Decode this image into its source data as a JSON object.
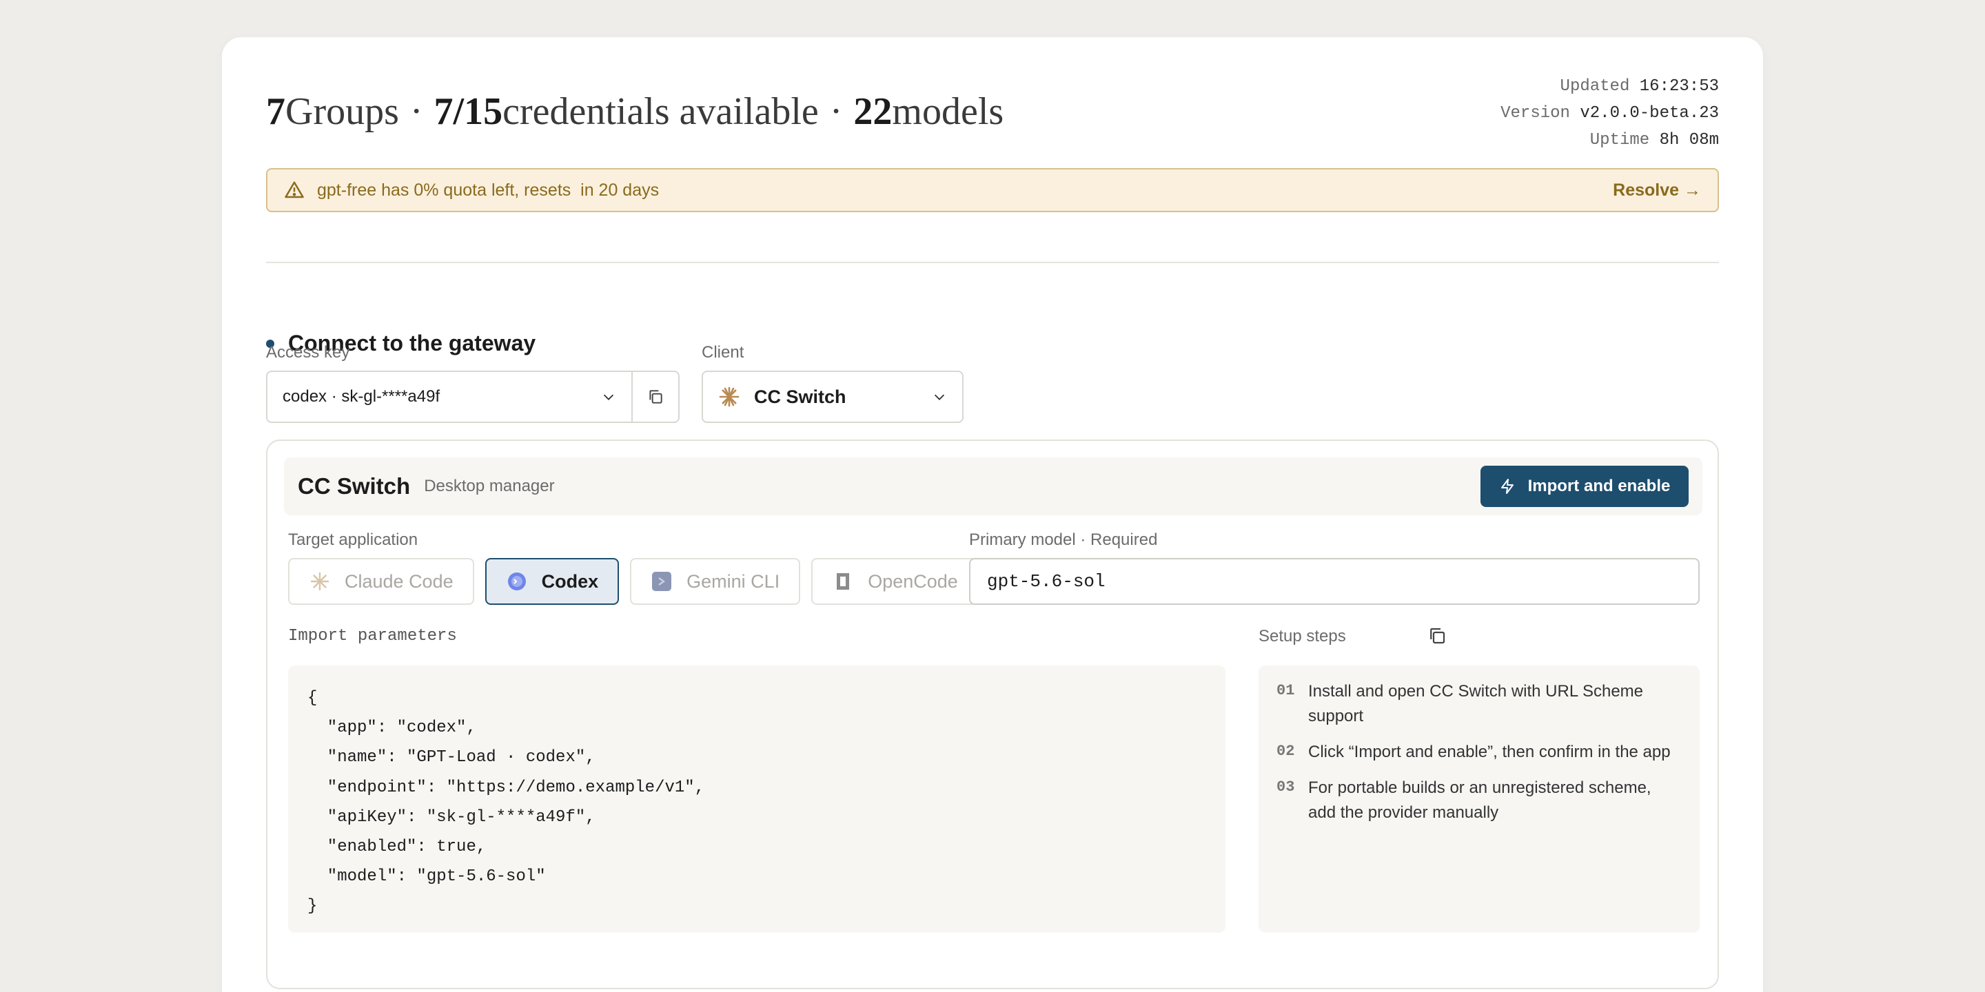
{
  "header": {
    "groups_count": "7",
    "groups_label": "Groups",
    "credentials_count": "7/15",
    "credentials_label": "credentials available",
    "models_count": "22",
    "models_label": "models",
    "separator": "·"
  },
  "meta": {
    "updated_label": "Updated",
    "updated_value": "16:23:53",
    "version_label": "Version",
    "version_value": "v2.0.0-beta.23",
    "uptime_label": "Uptime",
    "uptime_value": "8h 08m"
  },
  "banner": {
    "message": "gpt-free has 0% quota left, resets  in 20 days",
    "action": "Resolve →",
    "icon": "warning-triangle-icon"
  },
  "connect": {
    "title": "Connect to the gateway",
    "access_key_label": "Access key",
    "access_key_value": "codex · sk-gl-****a49f",
    "client_label": "Client",
    "client_value": "CC Switch"
  },
  "panel": {
    "title": "CC Switch",
    "subtitle": "Desktop manager",
    "import_button": "Import and enable",
    "target_label": "Target application",
    "apps": [
      {
        "label": "Claude Code",
        "icon": "claude-icon",
        "active": false
      },
      {
        "label": "Codex",
        "icon": "codex-icon",
        "active": true
      },
      {
        "label": "Gemini CLI",
        "icon": "gemini-icon",
        "active": false
      },
      {
        "label": "OpenCode",
        "icon": "opencode-icon",
        "active": false
      }
    ],
    "model_label": "Primary model · Required",
    "model_value": "gpt-5.6-sol",
    "params_label": "Import parameters",
    "code_lines": [
      "{",
      "  \"app\": \"codex\",",
      "  \"name\": \"GPT-Load · codex\",",
      "  \"endpoint\": \"https://demo.example/v1\",",
      "  \"apiKey\": \"sk-gl-****a49f\",",
      "  \"enabled\": true,",
      "  \"model\": \"gpt-5.6-sol\"",
      "}"
    ],
    "steps_label": "Setup steps",
    "steps": [
      {
        "n": "01",
        "text": "Install and open CC Switch with URL Scheme support"
      },
      {
        "n": "02",
        "text": "Click “Import and enable”, then confirm in the app"
      },
      {
        "n": "03",
        "text": "For portable builds or an unregistered scheme, add the provider manually"
      }
    ]
  },
  "colors": {
    "accent": "#1d4e6e",
    "warning_bg": "#faf0dd",
    "warning_text": "#8a6a1e",
    "page_bg": "#eeedea"
  }
}
